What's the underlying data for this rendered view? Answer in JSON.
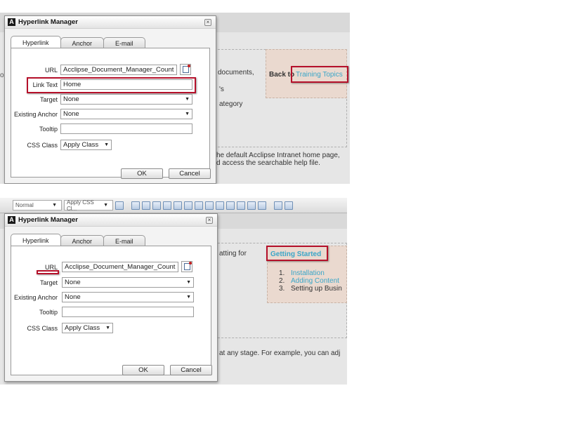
{
  "panel1": {
    "background": {
      "text_lines": [
        "documents,",
        "'s",
        "ategory"
      ],
      "back_to_label": "Back to",
      "back_to_link": "Training Topics",
      "bottom_lines": [
        "he default Acclipse Intranet home page,",
        "d access the searchable help file."
      ]
    },
    "dialog": {
      "title": "Hyperlink Manager",
      "tabs": [
        "Hyperlink",
        "Anchor",
        "E-mail"
      ],
      "fields": {
        "url_label": "URL",
        "url_value": "Acclipse_Document_Manager_Count",
        "link_text_label": "Link Text",
        "link_text_value": "Home",
        "target_label": "Target",
        "target_value": "None",
        "existing_anchor_label": "Existing Anchor",
        "existing_anchor_value": "None",
        "tooltip_label": "Tooltip",
        "tooltip_value": "",
        "css_class_label": "CSS Class",
        "css_class_value": "Apply Class"
      },
      "ok_label": "OK",
      "cancel_label": "Cancel"
    }
  },
  "panel2": {
    "toolbar": {
      "format_select": "Normal",
      "css_select": "Apply CSS Cl..."
    },
    "background": {
      "top_text": "atting for",
      "callout_title": "Getting Started",
      "list": [
        {
          "num": "1.",
          "text": "Installation",
          "link": true
        },
        {
          "num": "2.",
          "text": "Adding Content",
          "link": true
        },
        {
          "num": "3.",
          "text": "Setting up Busin",
          "link": false
        }
      ],
      "bottom_text": "at any stage. For example, you can adj"
    },
    "dialog": {
      "title": "Hyperlink Manager",
      "tabs": [
        "Hyperlink",
        "Anchor",
        "E-mail"
      ],
      "fields": {
        "url_label": "URL",
        "url_value": "Acclipse_Document_Manager_Count",
        "target_label": "Target",
        "target_value": "None",
        "existing_anchor_label": "Existing Anchor",
        "existing_anchor_value": "None",
        "tooltip_label": "Tooltip",
        "tooltip_value": "",
        "css_class_label": "CSS Class",
        "css_class_value": "Apply Class"
      },
      "ok_label": "OK",
      "cancel_label": "Cancel"
    }
  },
  "colors": {
    "highlight_border": "#b5102a",
    "link": "#3aa6c8",
    "callout_bg": "#ead9cf"
  },
  "icons": [
    "logo-icon",
    "close-icon",
    "url-browse-icon",
    "dropdown-caret-icon"
  ]
}
